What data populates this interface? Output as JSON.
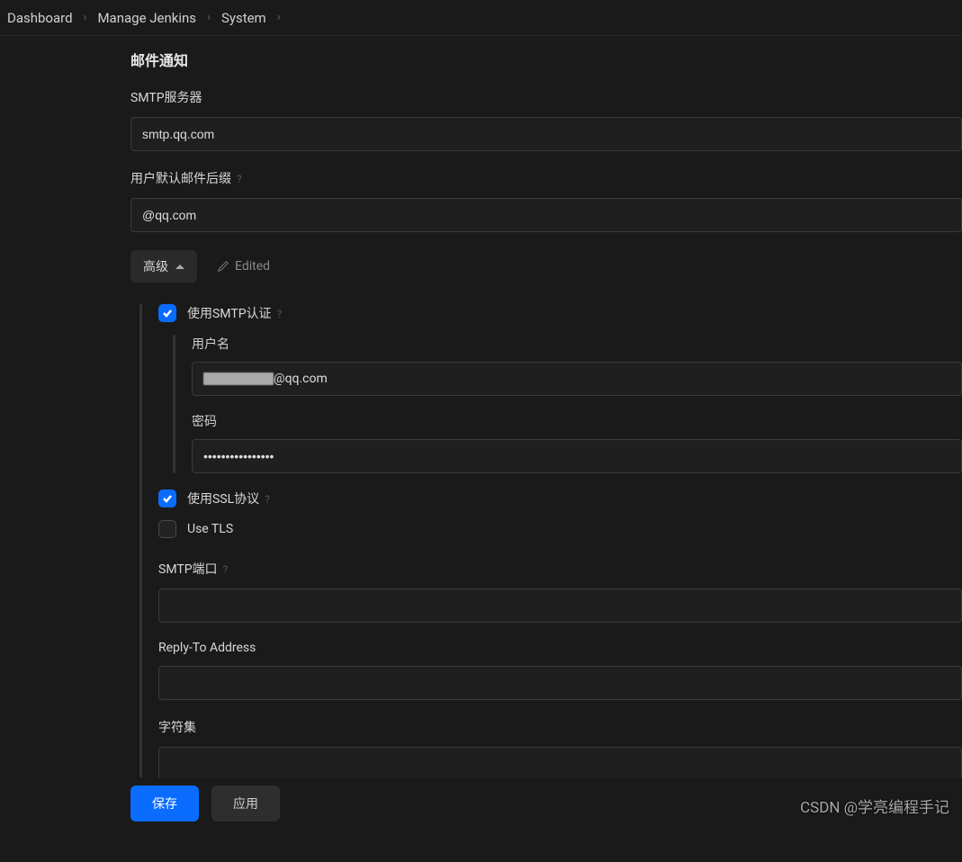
{
  "breadcrumb": {
    "items": [
      "Dashboard",
      "Manage Jenkins",
      "System"
    ]
  },
  "section": {
    "title": "邮件通知"
  },
  "fields": {
    "smtp_server": {
      "label": "SMTP服务器",
      "value": "smtp.qq.com"
    },
    "default_suffix": {
      "label": "用户默认邮件后缀",
      "value": "@qq.com"
    }
  },
  "advanced": {
    "button": "高级",
    "edited": "Edited"
  },
  "auth": {
    "use_smtp_auth": {
      "label": "使用SMTP认证",
      "checked": true
    },
    "username": {
      "label": "用户名",
      "suffix": "@qq.com"
    },
    "password": {
      "label": "密码",
      "value": "••••••••••••••••"
    },
    "use_ssl": {
      "label": "使用SSL协议",
      "checked": true
    },
    "use_tls": {
      "label": "Use TLS",
      "checked": false
    },
    "smtp_port": {
      "label": "SMTP端口",
      "value": ""
    },
    "reply_to": {
      "label": "Reply-To Address",
      "value": ""
    },
    "charset": {
      "label": "字符集",
      "value": ""
    }
  },
  "footer": {
    "save": "保存",
    "apply": "应用"
  },
  "watermark": "CSDN @学亮编程手记"
}
